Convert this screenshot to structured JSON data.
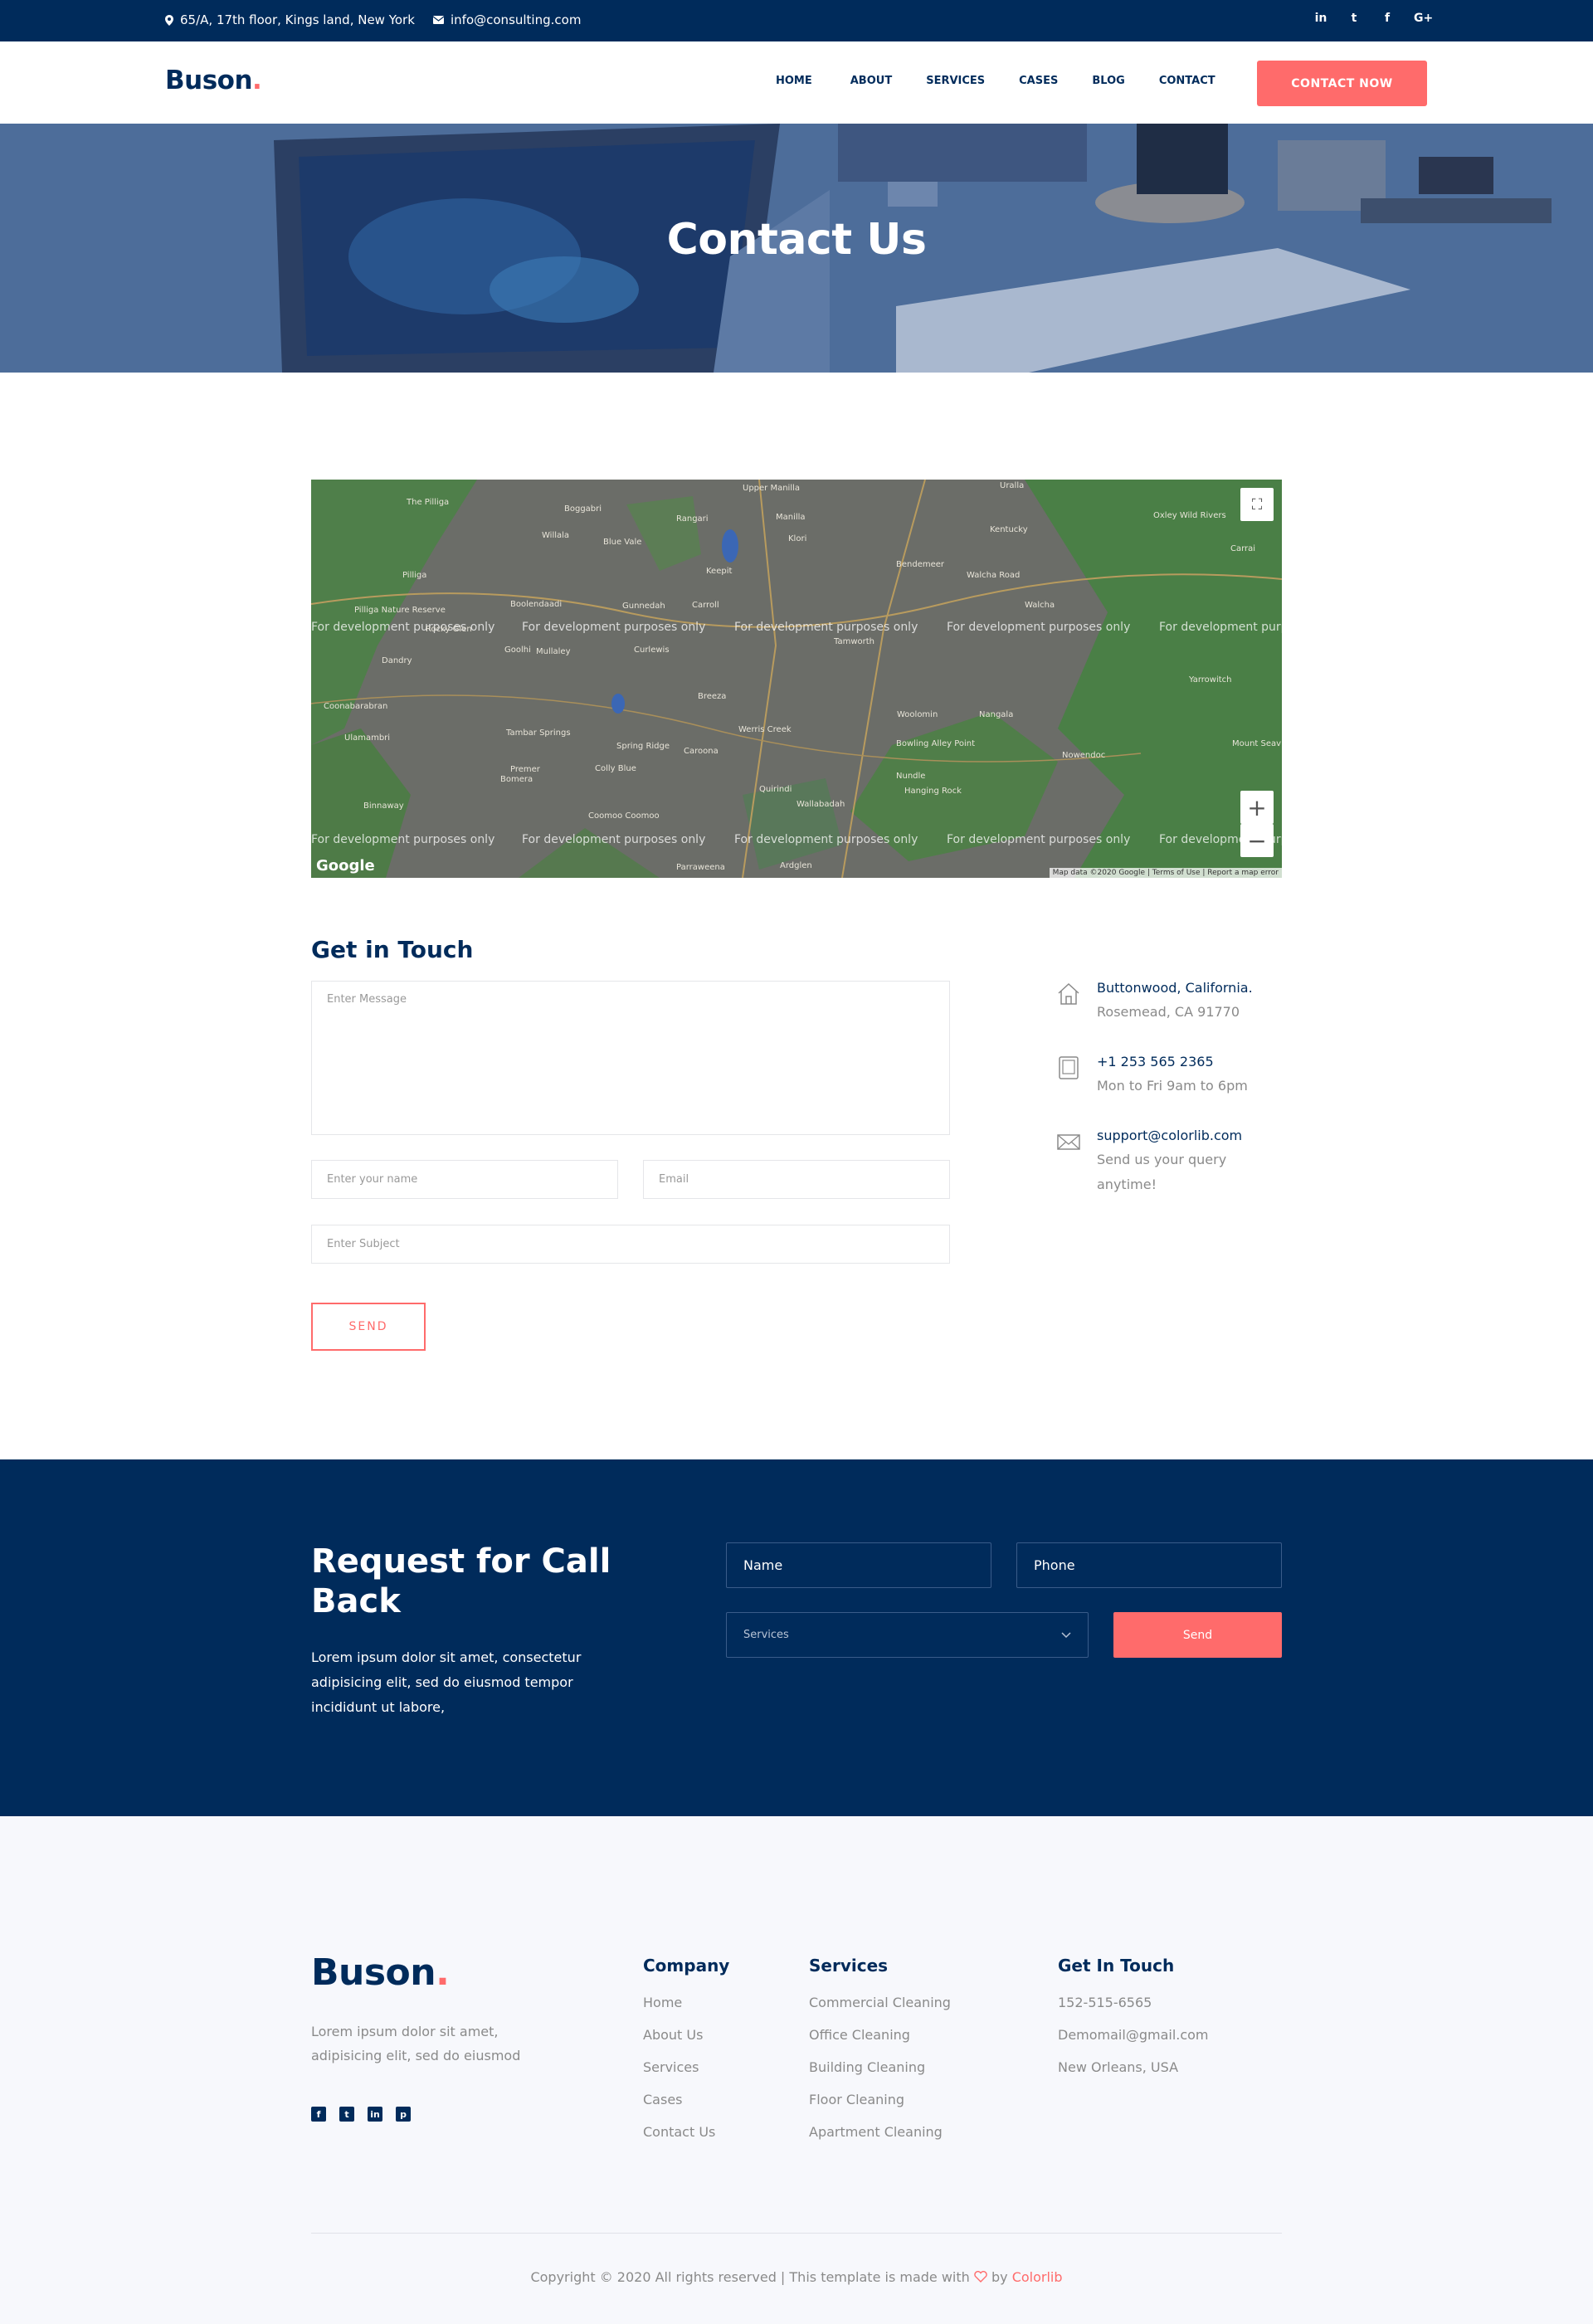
{
  "topbar": {
    "address": "65/A, 17th floor, Kings land, New York",
    "email": "info@consulting.com",
    "social": [
      "in",
      "t",
      "f",
      "G+"
    ]
  },
  "brand": {
    "name": "Buson",
    "dot": "."
  },
  "nav": {
    "items": [
      "HOME",
      "ABOUT",
      "SERVICES",
      "CASES",
      "BLOG",
      "CONTACT"
    ],
    "cta": "CONTACT NOW"
  },
  "hero": {
    "title": "Contact Us"
  },
  "map": {
    "watermark": "For development purposes only",
    "brand": "Google",
    "attribution": "Map data ©2020 Google | Terms of Use | Report a map error",
    "places": [
      "The Pilliga",
      "Boggabri",
      "Upper Manilla",
      "Manilla",
      "Uralla",
      "Kentucky",
      "Oxley Wild Rivers",
      "Willala",
      "Blue Vale",
      "Rangari",
      "Klori",
      "Pilliga",
      "Keepit",
      "Bendemeer",
      "Walcha Road",
      "Carrai",
      "Boolendaadi",
      "Gunnedah",
      "Carroll",
      "Pilliga Nature Reserve",
      "Walcha",
      "Rocky Glen",
      "Goolhi",
      "Mullaley",
      "Curlewis",
      "Tamworth",
      "Dandry",
      "Breeza",
      "Coonabarabran",
      "Woolomin",
      "Nangala",
      "Ulamambri",
      "Tambar Springs",
      "Werris Creek",
      "Spring Ridge",
      "Caroona",
      "Bowling Alley Point",
      "Nowendoc",
      "Mount Seaview",
      "Premer",
      "Bomera",
      "Colly Blue",
      "Nundle",
      "Hanging Rock",
      "Quirindi",
      "Wallabadah",
      "Binnaway",
      "Coomoo Coomoo",
      "Parraweena",
      "Ardglen",
      "Yarrowitch"
    ],
    "controls": {
      "fullscreen": "⛶",
      "zoom_in": "+",
      "zoom_out": "−"
    }
  },
  "contact": {
    "heading": "Get in Touch",
    "message_placeholder": "Enter Message",
    "name_placeholder": "Enter your name",
    "email_placeholder": "Email",
    "subject_placeholder": "Enter Subject",
    "send_label": "SEND",
    "info": [
      {
        "icon": "home-icon",
        "line1": "Buttonwood, California.",
        "line2": "Rosemead, CA 91770"
      },
      {
        "icon": "tablet-icon",
        "line1": "+1 253 565 2365",
        "line2": "Mon to Fri 9am to 6pm"
      },
      {
        "icon": "email-icon",
        "line1": "support@colorlib.com",
        "line2": "Send us your query anytime!"
      }
    ]
  },
  "callback": {
    "title": "Request for Call Back",
    "text": "Lorem ipsum dolor sit amet, consectetur adipisicing elit, sed do eiusmod tempor incididunt ut labore,",
    "name_label": "Name",
    "phone_label": "Phone",
    "services_label": "Services",
    "send_label": "Send"
  },
  "footer": {
    "about": "Lorem ipsum dolor sit amet, adipisicing elit, sed do eiusmod",
    "social": [
      "f",
      "t",
      "in",
      "p"
    ],
    "columns": [
      {
        "title": "Company",
        "items": [
          "Home",
          "About Us",
          "Services",
          "Cases",
          "Contact Us"
        ]
      },
      {
        "title": "Services",
        "items": [
          "Commercial Cleaning",
          "Office Cleaning",
          "Building Cleaning",
          "Floor Cleaning",
          "Apartment Cleaning"
        ]
      },
      {
        "title": "Get In Touch",
        "items": [
          "152-515-6565",
          "Demomail@gmail.com",
          "New Orleans, USA"
        ]
      }
    ],
    "copyright_prefix": "Copyright © 2020 All rights reserved | This template is made with",
    "copyright_by": "by",
    "copyright_link": "Colorlib"
  },
  "colors": {
    "navy": "#002b5b",
    "accent": "#ff6b6b",
    "map_land": "#6a6c66",
    "map_green": "#4f8a4a"
  }
}
